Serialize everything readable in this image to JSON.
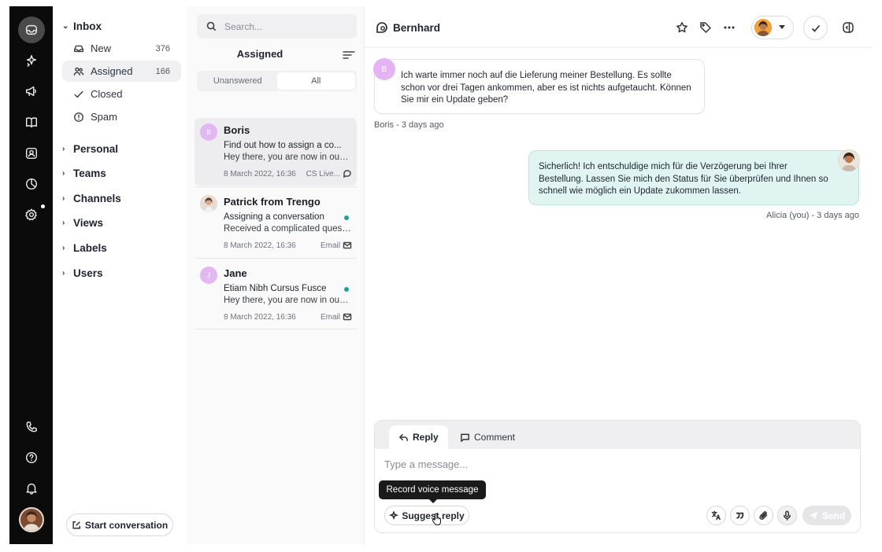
{
  "folders": {
    "inbox": "Inbox",
    "items": [
      {
        "label": "New",
        "count": "376"
      },
      {
        "label": "Assigned",
        "count": "166"
      },
      {
        "label": "Closed",
        "count": ""
      },
      {
        "label": "Spam",
        "count": ""
      }
    ],
    "groups": [
      "Personal",
      "Teams",
      "Channels",
      "Views",
      "Labels",
      "Users"
    ],
    "start_label": "Start conversation"
  },
  "list": {
    "search_placeholder": "Search...",
    "title": "Assigned",
    "filters": [
      "Unanswered",
      "All"
    ],
    "conversations": [
      {
        "initial": "B",
        "name": "Boris",
        "subject": "Find out how to assign a co...",
        "preview": "Hey there, you are now in our i...",
        "date": "8 March 2022, 16:36",
        "channel": "CS Live..."
      },
      {
        "initial": "",
        "name": "Patrick from Trengo",
        "subject": "Assigning a conversation",
        "preview": "Received a complicated quest...",
        "date": "8 March 2022, 16:36",
        "channel": "Email"
      },
      {
        "initial": "J",
        "name": "Jane",
        "subject": "Etiam Nibh Cursus Fusce",
        "preview": "Hey there, you are now in our i...",
        "date": "8 March 2022, 16:36",
        "channel": "Email"
      }
    ]
  },
  "chat": {
    "contact": "Bernhard",
    "incoming": {
      "initial": "B",
      "text": "Ich warte immer noch auf die Lieferung meiner Bestellung. Es sollte schon vor drei Tagen ankommen, aber es ist nichts aufgetaucht. Können Sie mir ein Update geben?",
      "meta": "Boris - 3 days ago"
    },
    "outgoing": {
      "text": "Sicherlich! Ich entschuldige mich für die Verzögerung bei Ihrer Bestellung. Lassen Sie mich den Status für Sie überprüfen und Ihnen so schnell wie möglich ein Update zukommen lassen.",
      "meta": "Alicia (you) - 3 days ago"
    }
  },
  "composer": {
    "tabs": [
      "Reply",
      "Comment"
    ],
    "placeholder": "Type a message...",
    "suggest": "Suggest reply",
    "send": "Send",
    "tooltip": "Record voice message"
  },
  "colors": {
    "rail": "#0b0b0b",
    "outgoing_bubble": "#e0f4f1",
    "accent_dot": "#20a09a",
    "avatar_purple": "#e2b8f2"
  }
}
